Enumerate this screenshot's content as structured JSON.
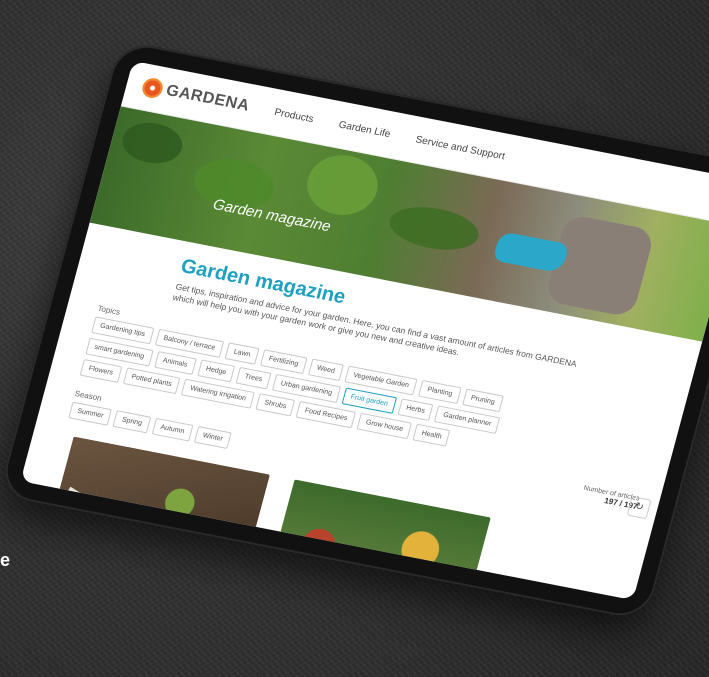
{
  "side_caption": "e",
  "brand": {
    "name": "GARDENA"
  },
  "nav": {
    "items": [
      "Products",
      "Garden Life",
      "Service and Support"
    ]
  },
  "hero": {
    "title": "Garden magazine"
  },
  "magazine": {
    "title": "Garden magazine",
    "intro": "Get tips, inspiration and advice for your garden. Here, you can find a vast amount of articles from GARDENA which will help you with your garden work or give you new and creative ideas."
  },
  "topics": {
    "label": "Topics",
    "items": [
      "Gardening tips",
      "Balcony / terrace",
      "Lawn",
      "Fertilizing",
      "Weed",
      "Vegetable Garden",
      "Planting",
      "Pruning",
      "smart gardening",
      "Animals",
      "Hedge",
      "Trees",
      "Urban gardening",
      "Fruit garden",
      "Herbs",
      "Garden planner",
      "Flowers",
      "Potted plants",
      "Watering irrigation",
      "Shrubs",
      "Food Recipes",
      "Grow house",
      "Health"
    ],
    "active": "Fruit garden"
  },
  "season": {
    "label": "Season",
    "items": [
      "Summer",
      "Spring",
      "Autumn",
      "Winter"
    ]
  },
  "articles": {
    "count_label": "Number of articles",
    "count_value": "197 / 197"
  },
  "icons": {
    "reset": "reset-icon",
    "logo": "gardena-flower-icon"
  },
  "colors": {
    "accent": "#1fa0c0",
    "brand_orange": "#e8551d"
  }
}
